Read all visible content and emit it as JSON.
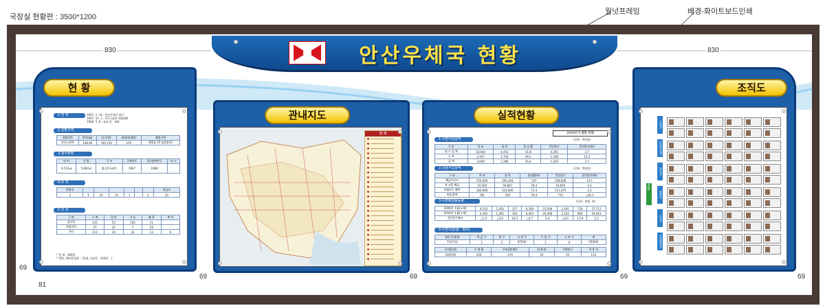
{
  "caption": "국장실 현황판 : 3500*1200",
  "callouts": {
    "wallet_frame": "월넛프레임",
    "background": "배경-화이트보드인쇄"
  },
  "dims": {
    "left_830": "830",
    "right_830": "830",
    "d69": "69",
    "d81": "81"
  },
  "header": {
    "title": "안산우체국 현황"
  },
  "panels": {
    "status": {
      "label": "현 황"
    },
    "map": {
      "label": "관내지도",
      "legend_title": "범 례"
    },
    "performance": {
      "label": "실적현황",
      "date_box": "2010년  5 월말 현재"
    },
    "org": {
      "label": "조직도"
    }
  },
  "status_sections": [
    "1.연    혁",
    "2.관할구역",
    "3.청사현황",
    "4.조    직",
    "5.인    원"
  ],
  "history_lines": [
    "1967.  2. 10 : 안산우체국 개국",
    "1997. 10.  1 : 3국 1실로 직제개편",
    "1989.  5.  8 : 청사 증 · 개축"
  ],
  "area_table": {
    "header": [
      "관할지역",
      "면적(㎢)",
      "인구(명)",
      "세대(천세대)",
      "행정구역"
    ],
    "row": [
      "안산시전역",
      "148.46",
      "740,730",
      "270",
      "행정동 25 법정동33"
    ]
  },
  "building_table": {
    "header": [
      "대 지",
      "건 물",
      "구 조",
      "건축년도",
      "증(개)축년도",
      "비 고"
    ],
    "row": [
      "4,531㎡",
      "5,987㎡",
      "철근콘크리트",
      "1967",
      "1989",
      ""
    ]
  },
  "org_table": {
    "header": [
      "본청국",
      "",
      "",
      "",
      "",
      "",
      "",
      "취급국"
    ],
    "row": [
      "3",
      "1",
      "34",
      "11",
      "1",
      "-",
      "2",
      "10"
    ]
  },
  "staff_table": {
    "header": [
      "구 분",
      "소 계",
      "일 반",
      "기 능",
      "별 정",
      "계 약"
    ],
    "row1": [
      "정규직",
      "215",
      "55",
      "150",
      "11",
      ""
    ],
    "row2": [
      "비정규직",
      "57",
      "21",
      "7",
      "29",
      "-"
    ],
    "row3": [
      "기타",
      "111",
      "20",
      "33",
      "13",
      "6",
      "37"
    ]
  },
  "status_notes": [
    "* 정 계 : 384명",
    "* 정원: 181명(일반 : 33명, 기능직 : 146명 ...)"
  ],
  "perf_sections": [
    "1.우편사업실적",
    "2.금융사업실적",
    "3.우편배달물동량",
    "4.우편사업(물 · 정비)"
  ],
  "perf_units": [
    "(단위 : 백만원)",
    "(단위 : 백만원)",
    "(단위 : 천통, %)"
  ],
  "perf_table1": {
    "header": [
      "구 분",
      "목 표",
      "실 적",
      "달 성 률",
      "전년동기",
      "전년동기대비"
    ],
    "rows": [
      [
        "총 수 입 액",
        "10,640",
        "4,452",
        "41.8",
        "4,305",
        "3.7"
      ],
      [
        "소 포",
        "3,347",
        "1,743",
        "49.2",
        "1,548",
        "12.3"
      ],
      [
        "금 계",
        "3,609",
        "1,280",
        "35.4",
        "1,243",
        "3.7"
      ]
    ]
  },
  "perf_table2": {
    "header": [
      "구 분",
      "목 표",
      "실 적",
      "달성률(%)",
      "전년동기",
      "전년동기대비"
    ],
    "rows": [
      [
        "예금수신고",
        "376,000",
        "295,264",
        "107",
        "258,836",
        "14.1"
      ],
      [
        "유 가증 예금",
        "72,500",
        "56,847",
        "78.4",
        "54,605",
        "4.1"
      ],
      [
        "보험료수 행액",
        "160,900",
        "114,660",
        "71.3",
        "111,475",
        "2.2"
      ],
      [
        "보험 환액",
        "781",
        "529",
        "70.4",
        "715",
        "△26.1"
      ]
    ]
  },
  "perf_table3": {
    "rows": [
      [
        "2009년 수출(누계)",
        "4,533",
        "1,450",
        "317",
        "6,300",
        "25,936",
        "2,445",
        "730",
        "27,711"
      ],
      [
        "2010년 수출(누계)",
        "4,465",
        "1,281",
        "303",
        "6,463",
        "26,368",
        "2,424",
        "800",
        "29,053"
      ],
      [
        "전년동기대비",
        "△1.5",
        "△4.6",
        "16.5",
        "△0.7",
        "2.4",
        "△0.9",
        "17.9",
        "2.5"
      ]
    ]
  },
  "perf_table4": {
    "header": [
      "총인구(세대)",
      "특 급 구",
      "특 구",
      "시 외 구",
      "수 집 구",
      "소 포 구",
      "계"
    ],
    "row": [
      "11(단지)",
      "2",
      "2",
      "4(역세)",
      "1",
      "0",
      "10(8개)"
    ]
  },
  "perf_table5": {
    "header": [
      "사서함(대)",
      "우 체 통",
      "우표류판매소",
      "집 배 원",
      "우편창구",
      "이 륜 차"
    ],
    "row": [
      "100(19)",
      "164",
      "274",
      "10",
      "12",
      "114"
    ]
  },
  "org_tree": {
    "root": "국장",
    "groups": [
      "우편과",
      "금융영업과",
      "영업과",
      "물류과",
      "소포과",
      "우편물류과"
    ]
  },
  "colors": {
    "frame": "#4a3a33",
    "panel_blue": "#1d5fa8",
    "title_yellow": "#ffe24a",
    "pill_gold": "#f2c200"
  }
}
